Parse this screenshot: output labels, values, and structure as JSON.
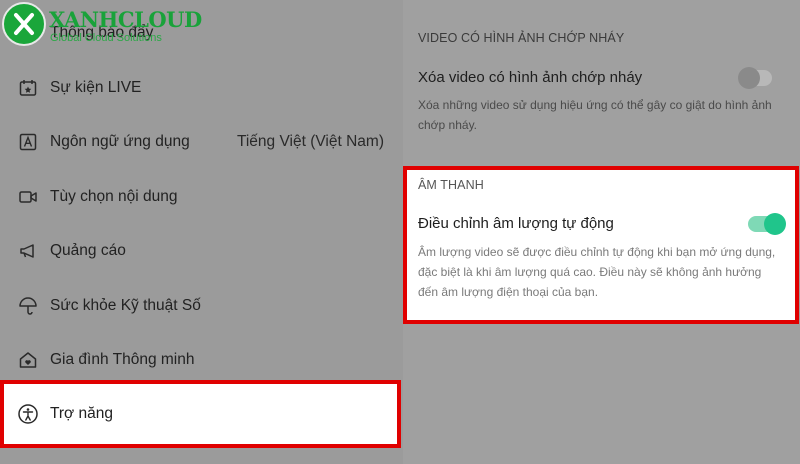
{
  "brand": {
    "name": "XANHCLOUD",
    "tagline": "Global Cloud Solutions",
    "accent": "#1aa63a"
  },
  "menu": {
    "items": [
      {
        "label": "Thông báo đẩy",
        "icon": "bell-icon"
      },
      {
        "label": "Sự kiện LIVE",
        "icon": "calendar-icon"
      },
      {
        "label": "Ngôn ngữ ứng dụng",
        "value": "Tiếng Việt (Việt Nam)",
        "icon": "language-icon"
      },
      {
        "label": "Tùy chọn nội dung",
        "icon": "video-camera-icon"
      },
      {
        "label": "Quảng cáo",
        "icon": "megaphone-icon"
      },
      {
        "label": "Sức khỏe Kỹ thuật Số",
        "icon": "umbrella-icon"
      },
      {
        "label": "Gia đình Thông minh",
        "icon": "home-heart-icon"
      },
      {
        "label": "Trợ năng",
        "icon": "accessibility-icon",
        "active": true
      }
    ]
  },
  "flash_section": {
    "header": "VIDEO CÓ HÌNH ẢNH CHỚP NHÁY",
    "title": "Xóa video có hình ảnh chớp nháy",
    "description": "Xóa những video sử dụng hiệu ứng có thể gây co giật do hình ảnh chớp nháy.",
    "enabled": false
  },
  "sound_section": {
    "header": "ÂM THANH",
    "title": "Điều chỉnh âm lượng tự động",
    "description": "Âm lượng video sẽ được điều chỉnh tự động khi bạn mở ứng dụng, đặc biệt là khi âm lượng quá cao. Điều này sẽ không ảnh hưởng đến âm lượng điện thoại của bạn.",
    "enabled": true
  },
  "colors": {
    "highlight": "#e00000",
    "toggle_on": "#20c58b"
  }
}
